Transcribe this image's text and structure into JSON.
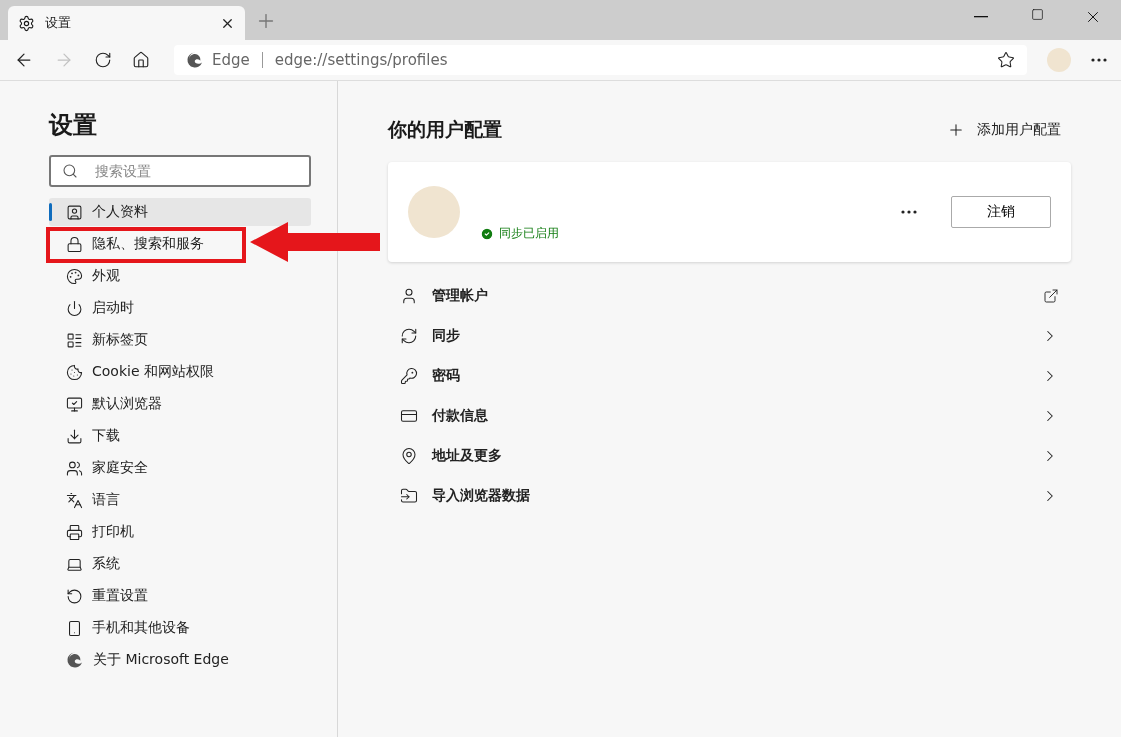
{
  "tab": {
    "title": "设置",
    "selected": true
  },
  "address": {
    "site": "Edge",
    "url": "edge://settings/profiles"
  },
  "sidebar": {
    "title": "设置",
    "search": {
      "placeholder": "搜索设置"
    },
    "items": [
      {
        "label": "个人资料",
        "selected": true,
        "highlighted": false
      },
      {
        "label": "隐私、搜索和服务",
        "selected": false,
        "highlighted": true
      },
      {
        "label": "外观",
        "selected": false,
        "highlighted": false
      },
      {
        "label": "启动时",
        "selected": false,
        "highlighted": false
      },
      {
        "label": "新标签页",
        "selected": false,
        "highlighted": false
      },
      {
        "label": "Cookie 和网站权限",
        "selected": false,
        "highlighted": false
      },
      {
        "label": "默认浏览器",
        "selected": false,
        "highlighted": false
      },
      {
        "label": "下载",
        "selected": false,
        "highlighted": false
      },
      {
        "label": "家庭安全",
        "selected": false,
        "highlighted": false
      },
      {
        "label": "语言",
        "selected": false,
        "highlighted": false
      },
      {
        "label": "打印机",
        "selected": false,
        "highlighted": false
      },
      {
        "label": "系统",
        "selected": false,
        "highlighted": false
      },
      {
        "label": "重置设置",
        "selected": false,
        "highlighted": false
      },
      {
        "label": "手机和其他设备",
        "selected": false,
        "highlighted": false
      },
      {
        "label": "关于 Microsoft Edge",
        "selected": false,
        "highlighted": false
      }
    ]
  },
  "main": {
    "title": "你的用户配置",
    "add_button": "添加用户配置",
    "profile": {
      "sync_status": "同步已启用",
      "sign_out": "注销"
    },
    "rows": [
      {
        "label": "管理帐户",
        "kind": "external"
      },
      {
        "label": "同步",
        "kind": "chevron"
      },
      {
        "label": "密码",
        "kind": "chevron"
      },
      {
        "label": "付款信息",
        "kind": "chevron"
      },
      {
        "label": "地址及更多",
        "kind": "chevron"
      },
      {
        "label": "导入浏览器数据",
        "kind": "chevron"
      }
    ]
  }
}
